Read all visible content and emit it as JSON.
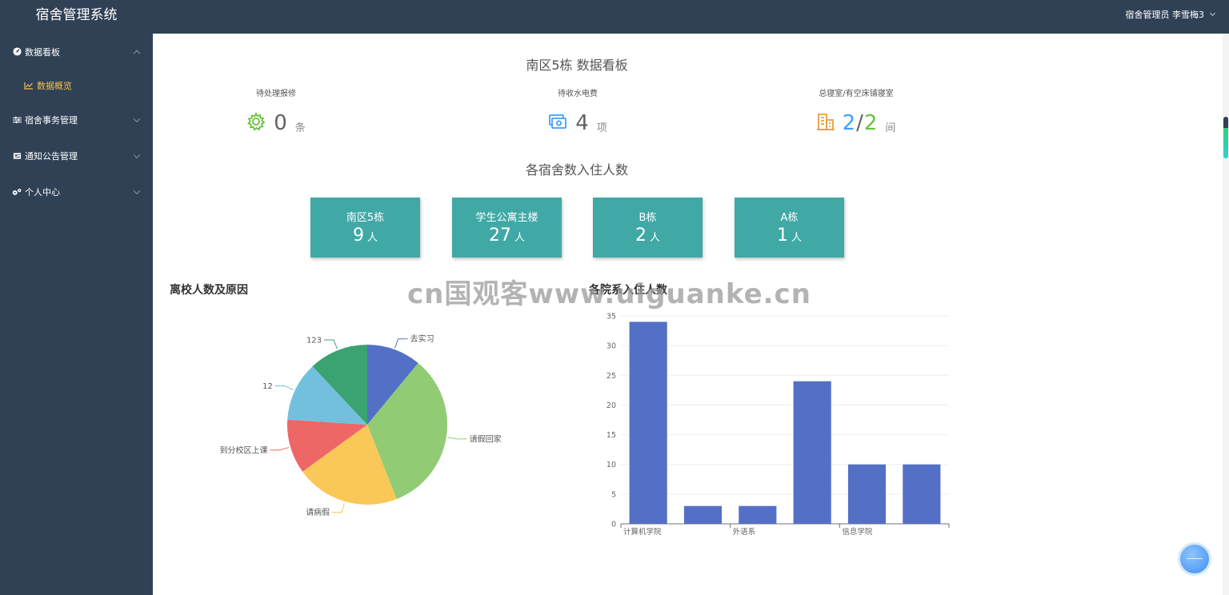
{
  "app": {
    "title": "宿舍管理系统"
  },
  "header": {
    "user": "宿舍管理员 李雪梅3"
  },
  "sidebar": {
    "items": [
      {
        "label": "数据看板",
        "icon": "dashboard-icon",
        "expanded": true,
        "children": [
          {
            "label": "数据概览",
            "icon": "chart-line-icon",
            "active": true
          }
        ]
      },
      {
        "label": "宿舍事务管理",
        "icon": "sliders-icon"
      },
      {
        "label": "通知公告管理",
        "icon": "newspaper-icon"
      },
      {
        "label": "个人中心",
        "icon": "cogs-icon"
      }
    ]
  },
  "dashboard": {
    "title": "南区5栋 数据看板",
    "stats": [
      {
        "label": "待处理报修",
        "value": "0",
        "unit": "条",
        "icon": "gear-icon",
        "color": "#67c23a"
      },
      {
        "label": "待收水电费",
        "value": "4",
        "unit": "项",
        "icon": "money-icon",
        "color": "#409eff"
      },
      {
        "label": "总寝室/有空床铺寝室",
        "value_total": "2",
        "sep": "/",
        "value_free": "2",
        "unit": "间",
        "icon": "building-icon",
        "color_icon": "#e6a23c",
        "color_total": "#409eff",
        "color_free": "#67c23a"
      }
    ],
    "occupancy_title": "各宿舍数入住人数",
    "buildings": [
      {
        "name": "南区5栋",
        "count": "9",
        "unit": "人"
      },
      {
        "name": "学生公寓主楼",
        "count": "27",
        "unit": "人"
      },
      {
        "name": "B栋",
        "count": "2",
        "unit": "人"
      },
      {
        "name": "A栋",
        "count": "1",
        "unit": "人"
      }
    ],
    "card_color": "#40a9a6"
  },
  "watermark": "cn国观客www.uiguanke.cn",
  "chart_data": [
    {
      "type": "pie",
      "title": "离校人数及原因",
      "slices": [
        {
          "name": "去实习",
          "value": 11,
          "color": "#5470c6"
        },
        {
          "name": "请假回家",
          "value": 33,
          "color": "#91cc75"
        },
        {
          "name": "请病假",
          "value": 21,
          "color": "#fac858"
        },
        {
          "name": "到分校区上课",
          "value": 11,
          "color": "#ee6666"
        },
        {
          "name": "12",
          "value": 12,
          "color": "#73c0de"
        },
        {
          "name": "123",
          "value": 12,
          "color": "#3ba272"
        }
      ]
    },
    {
      "type": "bar",
      "title": "各院系入住人数",
      "categories": [
        "计算机学院",
        "",
        "外语系",
        "",
        "信息学院",
        ""
      ],
      "values": [
        34,
        3,
        3,
        24,
        10,
        10
      ],
      "ylim": [
        0,
        35
      ],
      "yticks": [
        "0",
        "5",
        "10",
        "15",
        "20",
        "25",
        "30",
        "35"
      ],
      "grid": true,
      "color": "#5470c6"
    }
  ]
}
